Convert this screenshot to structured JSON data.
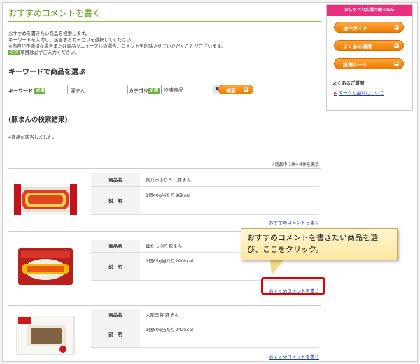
{
  "page": {
    "title": "おすすめコメントを書く",
    "intro": [
      "おすすめを書きたい商品を検索します。",
      "キーワードを入力し、該当するカテゴリを選択してください。",
      "※内容が不適切な場合または商品リニューアルの場合、コメントを削除させていただくことがございます。"
    ],
    "required_badge": "必須",
    "required_note": "項目は必ずご入力ください。"
  },
  "search": {
    "section_title": "キーワードで商品を選ぶ",
    "keyword_label": "キーワード",
    "keyword_value": "豚まん",
    "category_label": "カテゴリ",
    "category_value": "冷凍食品",
    "search_button": "検索"
  },
  "results": {
    "title": "(豚まんの検索結果)",
    "found_text": "4商品が該当しました。",
    "count_text": "4商品中 1件～4件を表示",
    "name_header": "商品名",
    "desc_header": "説　明",
    "link_label": "おすすめコメントを書く",
    "items": [
      {
        "name": "具たっぷりミニ豚まん",
        "desc": "1個40g当たり96kcal"
      },
      {
        "name": "具たっぷり豚まん",
        "desc": "1個85g当たり200kcal"
      },
      {
        "name": "大阪王将 豚まん",
        "desc": "1個80g当たり243kcal"
      }
    ]
  },
  "annotation": {
    "callout_text": "おすすめコメントを書きたい商品を選び、ここをクリック。"
  },
  "sidebar": {
    "header": "おしゃべり広場で困ったら",
    "buttons": [
      "操作ガイド",
      "よくある質問",
      "投稿ルール"
    ],
    "faq_header": "よくあるご質問",
    "faq_link": "マークと抽利について"
  },
  "colors": {
    "accent_green": "#8cc63f",
    "accent_orange": "#f07c00",
    "accent_pink": "#e92f80",
    "highlight_red": "#e00000"
  }
}
